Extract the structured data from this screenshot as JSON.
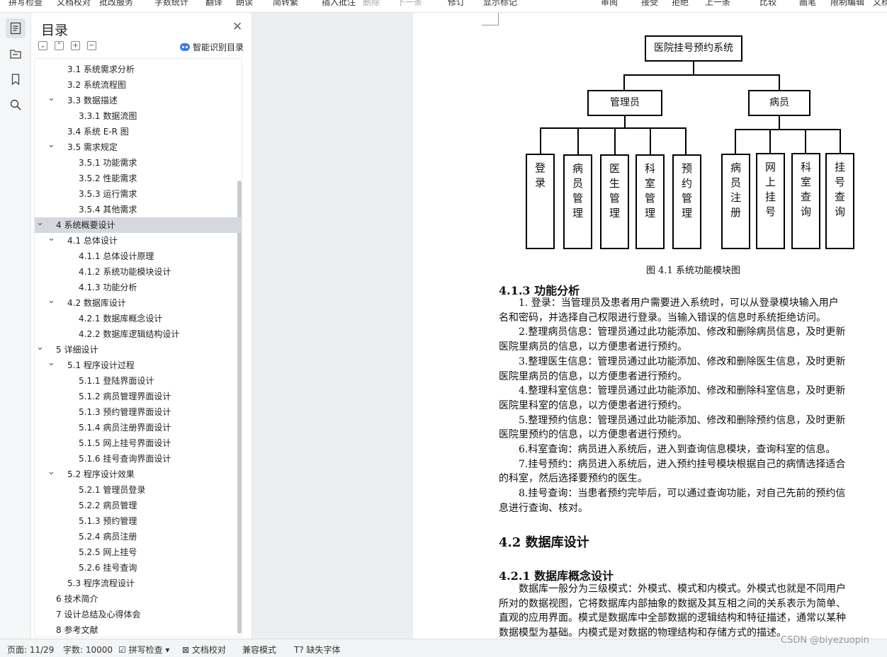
{
  "ribbon": {
    "items": [
      "拼写检查",
      "文档校对",
      "批改服务",
      "字数统计",
      "翻译",
      "朗读",
      "简转繁",
      "插入批注",
      "删除",
      "下一条",
      "修订",
      "显示标记",
      "审阅",
      "接受",
      "拒绝",
      "上一条",
      "比较",
      "画笔",
      "限制编辑",
      "文档"
    ]
  },
  "sidebar": {
    "title": "目录",
    "smart_label": "智能识别目录",
    "tools": [
      "⌄",
      "⌃",
      "+",
      "−"
    ],
    "items": [
      {
        "label": "3.1 系统需求分析",
        "level": 2,
        "chevron": ""
      },
      {
        "label": "3.2 系统流程图",
        "level": 2,
        "chevron": ""
      },
      {
        "label": "3.3 数据描述",
        "level": 2,
        "chevron": "v"
      },
      {
        "label": "3.3.1 数据流图",
        "level": 3,
        "chevron": ""
      },
      {
        "label": "3.4 系统 E-R 图",
        "level": 2,
        "chevron": ""
      },
      {
        "label": "3.5 需求规定",
        "level": 2,
        "chevron": "v"
      },
      {
        "label": "3.5.1 功能需求",
        "level": 3,
        "chevron": ""
      },
      {
        "label": "3.5.2 性能需求",
        "level": 3,
        "chevron": ""
      },
      {
        "label": "3.5.3 运行需求",
        "level": 3,
        "chevron": ""
      },
      {
        "label": "3.5.4 其他需求",
        "level": 3,
        "chevron": ""
      },
      {
        "label": "4 系统概要设计",
        "level": 1,
        "chevron": "v",
        "selected": true
      },
      {
        "label": "4.1 总体设计",
        "level": 2,
        "chevron": "v"
      },
      {
        "label": "4.1.1 总体设计原理",
        "level": 3,
        "chevron": ""
      },
      {
        "label": "4.1.2 系统功能模块设计",
        "level": 3,
        "chevron": ""
      },
      {
        "label": "4.1.3 功能分析",
        "level": 3,
        "chevron": ""
      },
      {
        "label": "4.2 数据库设计",
        "level": 2,
        "chevron": "v"
      },
      {
        "label": "4.2.1 数据库概念设计",
        "level": 3,
        "chevron": ""
      },
      {
        "label": "4.2.2 数据库逻辑结构设计",
        "level": 3,
        "chevron": ""
      },
      {
        "label": "5 详细设计",
        "level": 1,
        "chevron": "v"
      },
      {
        "label": "5.1 程序设计过程",
        "level": 2,
        "chevron": "v"
      },
      {
        "label": "5.1.1 登陆界面设计",
        "level": 3,
        "chevron": ""
      },
      {
        "label": "5.1.2 病员管理界面设计",
        "level": 3,
        "chevron": ""
      },
      {
        "label": "5.1.3 预约管理界面设计",
        "level": 3,
        "chevron": ""
      },
      {
        "label": "5.1.4 病员注册界面设计",
        "level": 3,
        "chevron": ""
      },
      {
        "label": "5.1.5 网上挂号界面设计",
        "level": 3,
        "chevron": ""
      },
      {
        "label": "5.1.6 挂号查询界面设计",
        "level": 3,
        "chevron": ""
      },
      {
        "label": "5.2 程序设计效果",
        "level": 2,
        "chevron": "v"
      },
      {
        "label": "5.2.1 管理员登录",
        "level": 3,
        "chevron": ""
      },
      {
        "label": "5.2.2 病员管理",
        "level": 3,
        "chevron": ""
      },
      {
        "label": "5.1.3 预约管理",
        "level": 3,
        "chevron": ""
      },
      {
        "label": "5.2.4 病员注册",
        "level": 3,
        "chevron": ""
      },
      {
        "label": "5.2.5 网上挂号",
        "level": 3,
        "chevron": ""
      },
      {
        "label": "5.2.6 挂号查询",
        "level": 3,
        "chevron": ""
      },
      {
        "label": "5.3 程序流程设计",
        "level": 2,
        "chevron": ""
      },
      {
        "label": "6 技术简介",
        "level": 1,
        "chevron": ""
      },
      {
        "label": "7 设计总结及心得体会",
        "level": 1,
        "chevron": ""
      },
      {
        "label": "8 参考文献",
        "level": 1,
        "chevron": ""
      }
    ]
  },
  "diagram": {
    "root": "医院挂号预约系统",
    "admin": "管理员",
    "patient": "病员",
    "admin_modules": [
      "登录",
      "病员管理",
      "医生管理",
      "科室管理",
      "预约管理"
    ],
    "patient_modules": [
      "病员注册",
      "网上挂号",
      "科室查询",
      "挂号查询"
    ],
    "caption": "图 4.1 系统功能模块图"
  },
  "document": {
    "h413": "4.1.3 功能分析",
    "lines_413": [
      "　　1. 登录：当管理员及患者用户需要进入系统时，可以从登录模块输入用户",
      "名和密码，并选择自己权限进行登录。当输入错误的信息时系统拒绝访问。",
      "　　2.整理病员信息：管理员通过此功能添加、修改和删除病员信息，及时更新",
      "医院里病员的信息，以方便患者进行预约。",
      "　　3.整理医生信息：管理员通过此功能添加、修改和删除医生信息，及时更新",
      "医院里病员的信息，以方便患者进行预约。",
      "　　4.整理科室信息：管理员通过此功能添加、修改和删除科室信息，及时更新",
      "医院里科室的信息，以方便患者进行预约。",
      "　　5.整理预约信息：管理员通过此功能添加、修改和删除预约信息，及时更新",
      "医院里预约的信息，以方便患者进行预约。",
      "　　6.科室查询：病员进入系统后，进入到查询信息模块，查询科室的信息。",
      "　　7.挂号预约：病员进入系统后，进入预约挂号模块根据自己的病情选择适合",
      "的科室，然后选择要预约的医生。",
      "　　8.挂号查询：当患者预约完毕后，可以通过查询功能，对自己先前的预约信",
      "息进行查询、核对。"
    ],
    "h42": "4.2 数据库设计",
    "h421": "4.2.1 数据库概念设计",
    "lines_421": [
      "　　数据库一般分为三级模式：外模式、模式和内模式。外模式也就是不同用户",
      "所对的数据视图，它将数据库内部抽象的数据及其互相之间的关系表示为简单、",
      "直观的应用界面。模式是数据库中全部数据的逻辑结构和特征描述，通常以某种",
      "数据模型为基础。内模式是对数据的物理结构和存储方式的描述。"
    ]
  },
  "status": {
    "page": "页面: 11/29",
    "words": "字数: 10000",
    "spell": "拼写检查",
    "proof": "文档校对",
    "compat": "兼容模式",
    "missing_font": "缺失字体",
    "watermark": "CSDN @biyezuopin"
  }
}
